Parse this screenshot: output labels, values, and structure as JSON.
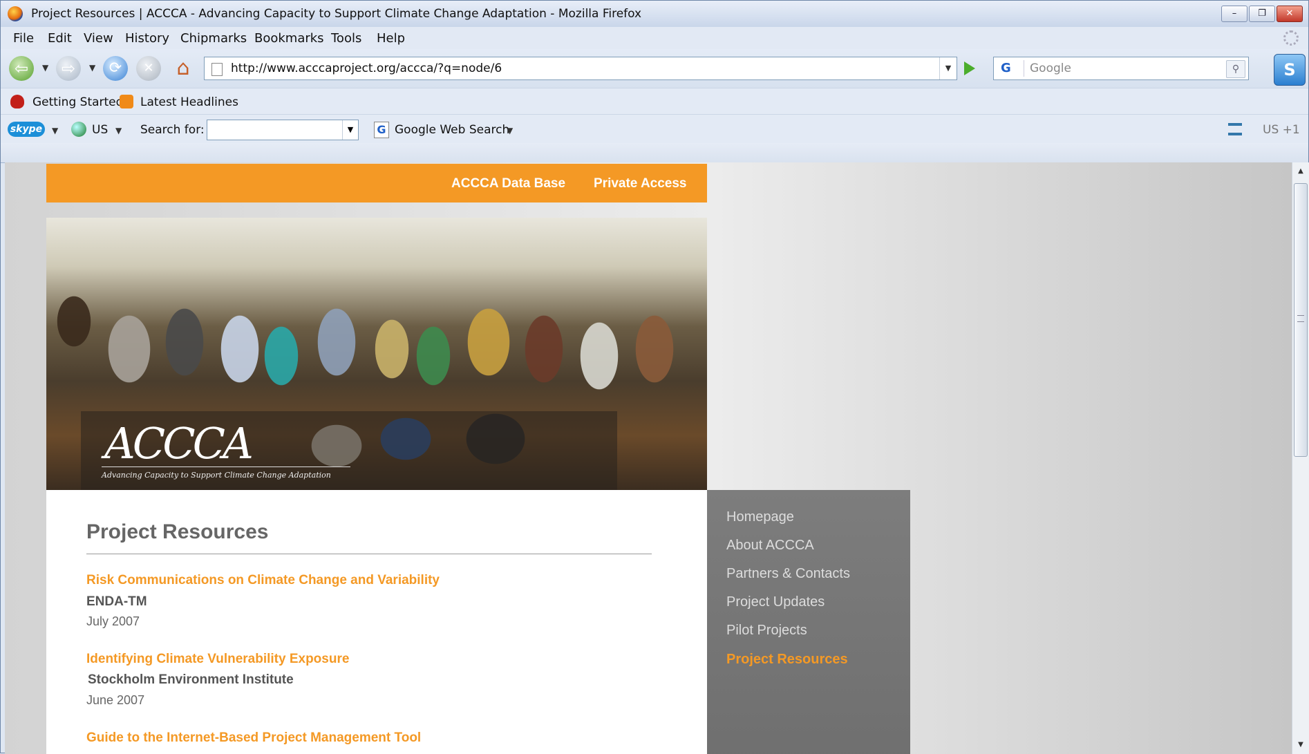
{
  "window": {
    "title": "Project Resources | ACCCA - Advancing Capacity to Support Climate Change Adaptation - Mozilla Firefox",
    "minimize": "–",
    "restore": "❐",
    "close": "✕"
  },
  "menu": [
    "File",
    "Edit",
    "View",
    "History",
    "Chipmarks",
    "Bookmarks",
    "Tools",
    "Help"
  ],
  "navbar": {
    "url": "http://www.acccaproject.org/accca/?q=node/6",
    "search_engine": "G",
    "search_placeholder": "Google"
  },
  "bookmarks": [
    "Getting Started",
    "Latest Headlines"
  ],
  "skype_toolbar": {
    "logo": "skype",
    "country": "US",
    "search_label": "Search for:",
    "search_value": "",
    "web_search": "Google Web Search",
    "phone_code": "US +1"
  },
  "site": {
    "top_links": [
      "ACCCA Data Base",
      "Private Access"
    ],
    "logo_text": "ACCCA",
    "logo_subtitle": "Advancing Capacity to Support Climate Change Adaptation",
    "page_title": "Project Resources",
    "resources": [
      {
        "title": "Risk Communications on Climate Change and Variability",
        "org": "ENDA-TM",
        "date": "July 2007"
      },
      {
        "title": "Identifying Climate Vulnerability Exposure",
        "org": "Stockholm Environment Institute",
        "date": "June 2007"
      },
      {
        "title": "Guide to the Internet-Based Project Management Tool",
        "org": "",
        "date": ""
      }
    ],
    "side_nav": [
      "Homepage",
      "About ACCCA",
      "Partners & Contacts",
      "Project Updates",
      "Pilot Projects",
      "Project Resources"
    ],
    "active_nav": "Project Resources"
  },
  "colors": {
    "accent": "#f49925",
    "sidenav_bg": "#777777",
    "text_gray": "#666666"
  }
}
